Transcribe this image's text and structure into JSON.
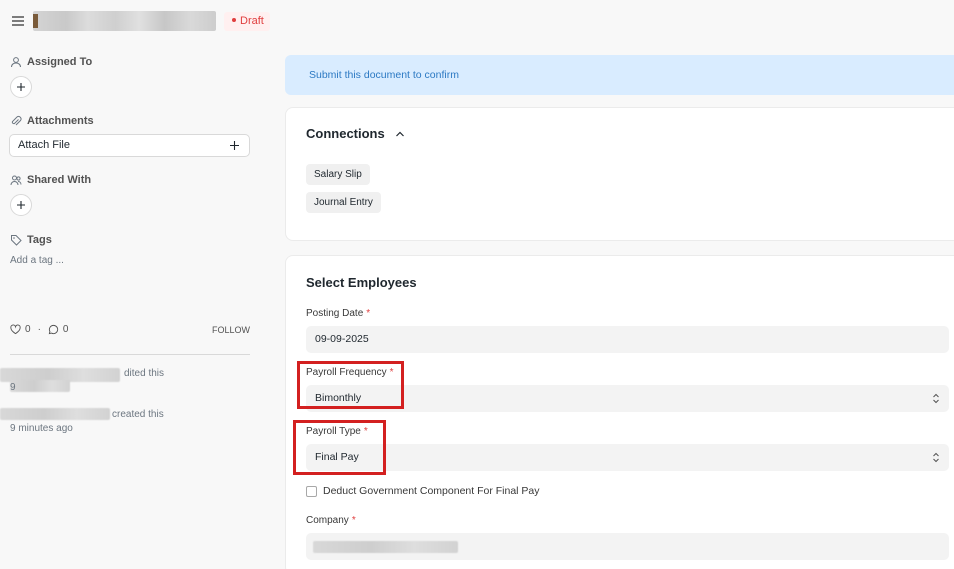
{
  "header": {
    "status_badge": "Draft"
  },
  "sidebar": {
    "assigned_to_label": "Assigned To",
    "attachments_label": "Attachments",
    "attach_file_label": "Attach File",
    "shared_with_label": "Shared With",
    "tags_label": "Tags",
    "add_tag_label": "Add a tag ...",
    "likes_count": "0",
    "comments_count": "0",
    "follow_label": "FOLLOW",
    "activity": [
      {
        "action": "dited this",
        "time": "9"
      },
      {
        "action": "created this",
        "time": "9 minutes ago"
      }
    ]
  },
  "banner": {
    "text": "Submit this document to confirm"
  },
  "connections": {
    "title": "Connections",
    "items": [
      "Salary Slip",
      "Journal Entry"
    ]
  },
  "form": {
    "section_title": "Select Employees",
    "posting_date_label": "Posting Date",
    "posting_date_value": "09-09-2025",
    "payroll_frequency_label": "Payroll Frequency",
    "payroll_frequency_value": "Bimonthly",
    "payroll_type_label": "Payroll Type",
    "payroll_type_value": "Final Pay",
    "deduct_label": "Deduct Government Component For Final Pay",
    "company_label": "Company",
    "required_mark": "*"
  },
  "colors": {
    "accent_blue": "#2c79c3",
    "banner_bg": "#d9ecff",
    "draft_red": "#e03e3e",
    "highlight_red": "#d32020"
  }
}
